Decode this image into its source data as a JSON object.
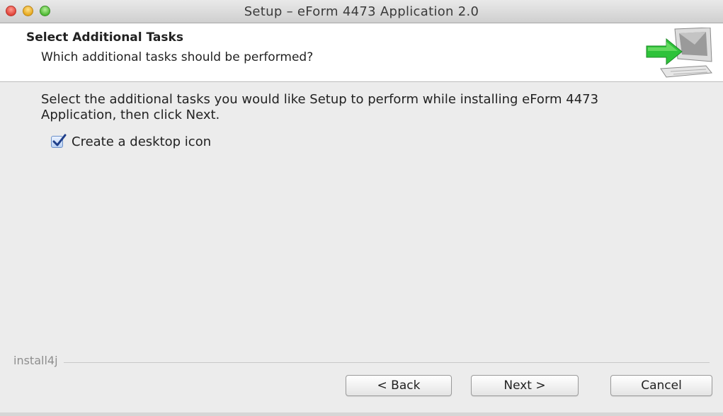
{
  "window": {
    "title": "Setup – eForm 4473 Application 2.0"
  },
  "header": {
    "title": "Select Additional Tasks",
    "subtitle": "Which additional tasks should be performed?",
    "graphic_icon": "setup-wizard-computer-arrow-icon"
  },
  "content": {
    "instructions": "Select the additional tasks you would like Setup to perform while installing eForm 4473 Application, then click Next.",
    "tasks": [
      {
        "label": "Create a desktop icon",
        "checked": true
      }
    ]
  },
  "footer": {
    "brand": "install4j",
    "back_label": "< Back",
    "next_label": "Next >",
    "cancel_label": "Cancel"
  },
  "colors": {
    "close": "#e0443a",
    "minimize": "#e6a81e",
    "zoom": "#4fb935",
    "arrow": "#2ec23a",
    "checkbox": "#b9d0f3"
  }
}
